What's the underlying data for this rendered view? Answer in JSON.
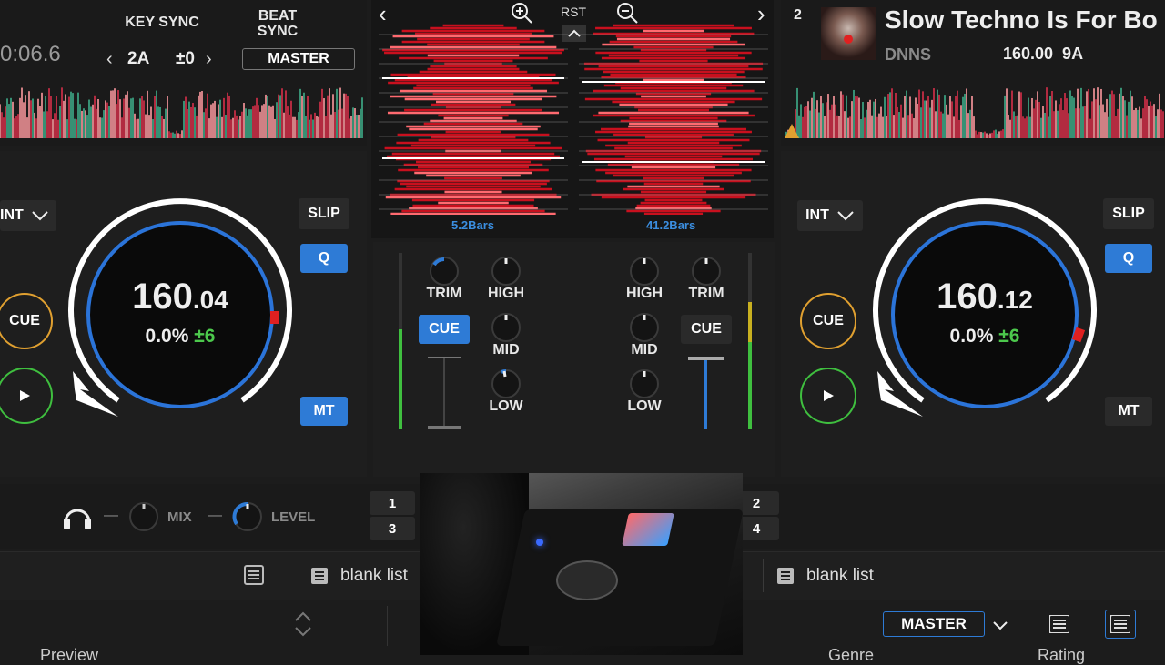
{
  "deck1": {
    "time": "0:06.6",
    "key_sync": "KEY SYNC",
    "beat_sync_line1": "BEAT",
    "beat_sync_line2": "SYNC",
    "key": "2A",
    "key_offset": "±0",
    "master": "MASTER",
    "int": "INT",
    "slip": "SLIP",
    "q": "Q",
    "mt": "MT",
    "cue": "CUE",
    "bpm_int": "160",
    "bpm_dec": ".04",
    "pitch": "0.0%",
    "range": "±6"
  },
  "deck2": {
    "number": "2",
    "title": "Slow Techno Is For Bo",
    "artist": "DNNS",
    "bpm_key": "160.00  9A",
    "int": "INT",
    "slip": "SLIP",
    "q": "Q",
    "mt": "MT",
    "cue": "CUE",
    "bpm_int": "160",
    "bpm_dec": ".12",
    "pitch": "0.0%",
    "range": "±6"
  },
  "zoom": {
    "rst": "RST",
    "left_bars": "5.2Bars",
    "right_bars": "41.2Bars"
  },
  "mixer": {
    "trim": "TRIM",
    "high": "HIGH",
    "mid": "MID",
    "low": "LOW",
    "cue": "CUE"
  },
  "headphones": {
    "mix": "MIX",
    "level": "LEVEL"
  },
  "deck_select": [
    "1",
    "3",
    "2",
    "4"
  ],
  "browser": {
    "left_list": "blank list",
    "right_list": "blank list",
    "master": "MASTER",
    "col_preview": "Preview",
    "col_genre": "Genre",
    "col_rating": "Rating"
  },
  "colors": {
    "accent_blue": "#2e7bd6",
    "play_green": "#3fbf3f",
    "cue_orange": "#e0a030",
    "waveform_red": "#e0202a",
    "key_green": "#4cc84c"
  }
}
